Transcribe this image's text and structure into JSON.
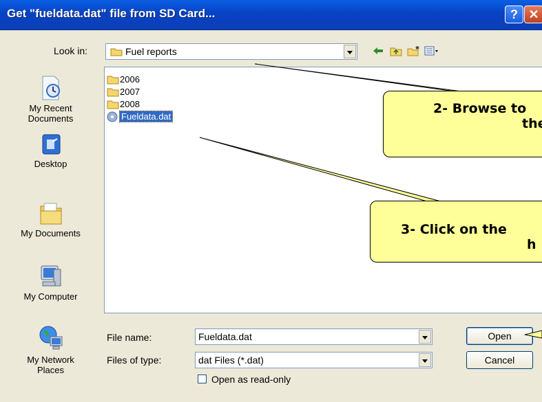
{
  "window": {
    "title": "Get \"fueldata.dat\" file from SD Card...",
    "help_glyph": "?",
    "close_glyph": "✕"
  },
  "look_in": {
    "label": "Look in:",
    "value": "Fuel reports"
  },
  "places": [
    {
      "label_1": "My Recent",
      "label_2": "Documents",
      "icon": "recent-documents-icon"
    },
    {
      "label_1": "Desktop",
      "icon": "desktop-icon"
    },
    {
      "label_1": "My Documents",
      "icon": "my-documents-icon"
    },
    {
      "label_1": "My Computer",
      "icon": "my-computer-icon"
    },
    {
      "label_1": "My Network",
      "label_2": "Places",
      "icon": "network-places-icon"
    }
  ],
  "files": [
    {
      "name": "2006",
      "type": "folder"
    },
    {
      "name": "2007",
      "type": "folder"
    },
    {
      "name": "2008",
      "type": "folder"
    },
    {
      "name": "Fueldata.dat",
      "type": "file",
      "selected": true
    }
  ],
  "file_name": {
    "label": "File name:",
    "value": "Fueldata.dat"
  },
  "file_type": {
    "label": "Files of type:",
    "value": "dat Files (*.dat)"
  },
  "read_only": {
    "label": "Open as read-only"
  },
  "buttons": {
    "open": "Open",
    "cancel": "Cancel"
  },
  "callouts": {
    "browse_line1": "2- Browse to",
    "browse_line2": "the",
    "click_line1": "3- Click on the",
    "click_line2": "h"
  },
  "colors": {
    "callout_fill": "#ffff99",
    "titlebar": "#0842c4",
    "selection": "#316ac5"
  }
}
